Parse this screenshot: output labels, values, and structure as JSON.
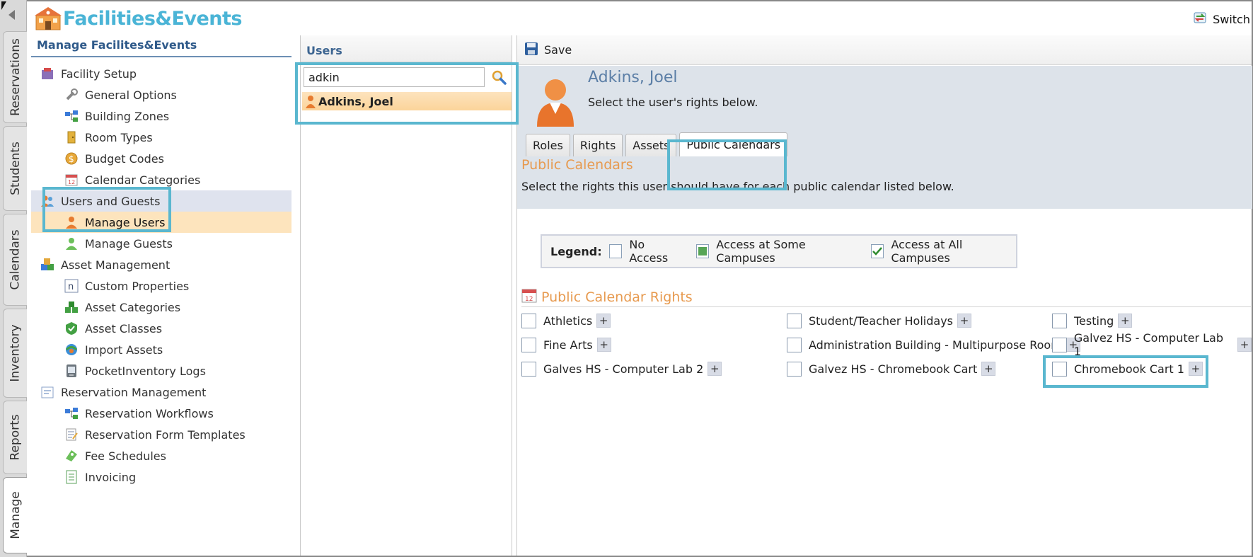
{
  "app": {
    "title": "Facilities&Events",
    "switch_label": "Switch"
  },
  "side_tabs": [
    {
      "label": "Reservations"
    },
    {
      "label": "Students"
    },
    {
      "label": "Calendars"
    },
    {
      "label": "Inventory"
    },
    {
      "label": "Reports"
    },
    {
      "label": "Manage",
      "active": true
    }
  ],
  "nav": {
    "title": "Manage Facilites&Events",
    "items": [
      {
        "label": "Facility Setup",
        "level": 1,
        "icon": "facility-setup-icon"
      },
      {
        "label": "General Options",
        "level": 2,
        "icon": "wrench-icon"
      },
      {
        "label": "Building Zones",
        "level": 2,
        "icon": "zones-icon"
      },
      {
        "label": "Room Types",
        "level": 2,
        "icon": "door-icon"
      },
      {
        "label": "Budget Codes",
        "level": 2,
        "icon": "budget-icon"
      },
      {
        "label": "Calendar Categories",
        "level": 2,
        "icon": "calendar-icon"
      },
      {
        "label": "Users and Guests",
        "level": 1,
        "icon": "users-icon"
      },
      {
        "label": "Manage Users",
        "level": 2,
        "icon": "user-icon",
        "selected": true
      },
      {
        "label": "Manage Guests",
        "level": 2,
        "icon": "guest-icon"
      },
      {
        "label": "Asset Management",
        "level": 1,
        "icon": "asset-management-icon"
      },
      {
        "label": "Custom Properties",
        "level": 2,
        "icon": "custom-properties-icon"
      },
      {
        "label": "Asset Categories",
        "level": 2,
        "icon": "asset-categories-icon"
      },
      {
        "label": "Asset Classes",
        "level": 2,
        "icon": "asset-classes-icon"
      },
      {
        "label": "Import Assets",
        "level": 2,
        "icon": "import-icon"
      },
      {
        "label": "PocketInventory Logs",
        "level": 2,
        "icon": "logs-icon"
      },
      {
        "label": "Reservation Management",
        "level": 1,
        "icon": "reservation-management-icon"
      },
      {
        "label": "Reservation Workflows",
        "level": 2,
        "icon": "workflow-icon"
      },
      {
        "label": "Reservation Form Templates",
        "level": 2,
        "icon": "form-template-icon"
      },
      {
        "label": "Fee Schedules",
        "level": 2,
        "icon": "fee-icon"
      },
      {
        "label": "Invoicing",
        "level": 2,
        "icon": "invoice-icon"
      }
    ]
  },
  "users_panel": {
    "title": "Users",
    "search_value": "adkin",
    "results": [
      {
        "name": "Adkins, Joel"
      }
    ]
  },
  "detail": {
    "save_label": "Save",
    "user_name": "Adkins, Joel",
    "user_sub": "Select the user's rights below.",
    "tabs": [
      {
        "label": "Roles"
      },
      {
        "label": "Rights"
      },
      {
        "label": "Assets"
      },
      {
        "label": "Public Calendars",
        "active": true
      }
    ],
    "section_title": "Public Calendars",
    "section_desc": "Select the rights this user should have for each public calendar listed below.",
    "legend": {
      "label": "Legend:",
      "none": "No Access",
      "some": "Access at Some Campuses",
      "all": "Access at All Campuses"
    },
    "rights_title": "Public Calendar Rights",
    "calendars": [
      {
        "label": "Athletics",
        "checked": false
      },
      {
        "label": "Student/Teacher Holidays",
        "checked": false
      },
      {
        "label": "Testing",
        "checked": false
      },
      {
        "label": "Fine Arts",
        "checked": false
      },
      {
        "label": "Administration Building - Multipurpose Room",
        "checked": false
      },
      {
        "label": "Galvez HS - Computer Lab 1",
        "checked": false
      },
      {
        "label": "Galves HS - Computer Lab 2",
        "checked": false
      },
      {
        "label": "Galvez HS - Chromebook Cart",
        "checked": false
      },
      {
        "label": "Chromebook Cart 1",
        "checked": false
      }
    ]
  },
  "colors": {
    "accent": "#4ab4d6",
    "highlight": "#5ab7cf",
    "section_orange": "#e79a4f",
    "selected_row": "#fde4bd"
  }
}
